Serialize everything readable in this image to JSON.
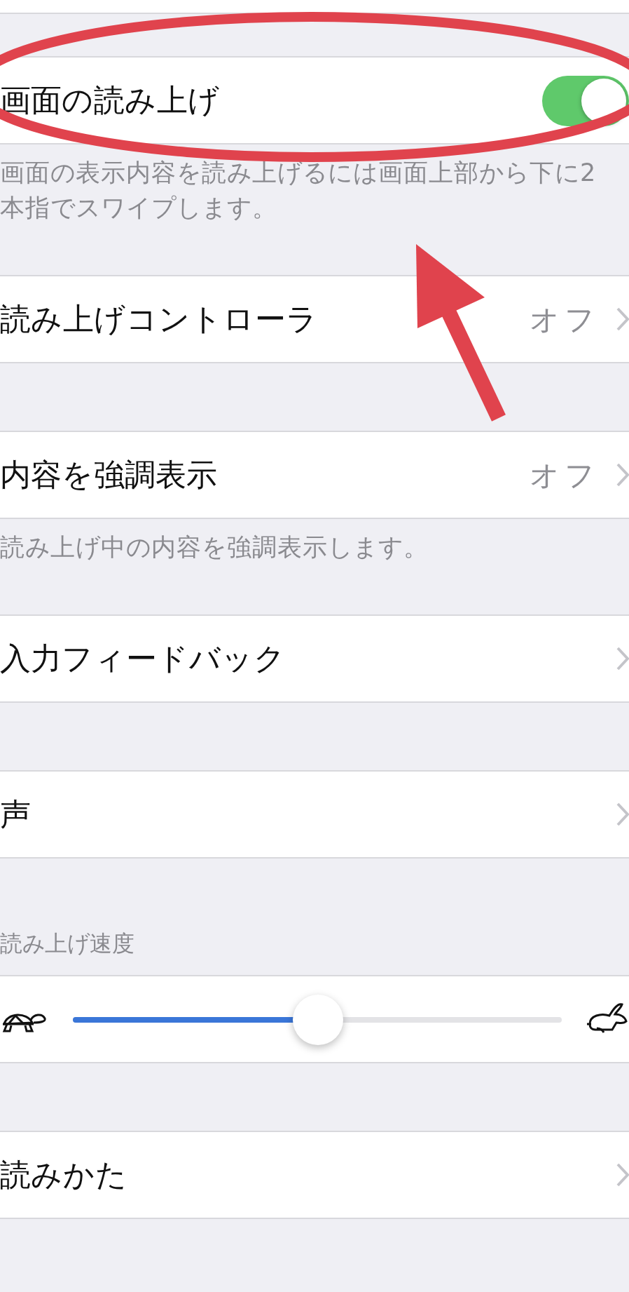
{
  "groups": [
    {
      "rows": [
        {
          "kind": "toggle",
          "label": "画面の読み上げ",
          "on": true
        }
      ],
      "footer": "画面の表示内容を読み上げるには画面上部から下に2本指でスワイプします。"
    },
    {
      "rows": [
        {
          "kind": "link",
          "label": "読み上げコントローラ",
          "value": "オフ"
        }
      ]
    },
    {
      "rows": [
        {
          "kind": "link",
          "label": "内容を強調表示",
          "value": "オフ"
        }
      ],
      "footer": "読み上げ中の内容を強調表示します。"
    },
    {
      "rows": [
        {
          "kind": "link",
          "label": "入力フィードバック"
        }
      ]
    },
    {
      "rows": [
        {
          "kind": "link",
          "label": "声"
        }
      ]
    },
    {
      "header": "読み上げ速度",
      "rows": [
        {
          "kind": "slider",
          "level": 0.5
        }
      ]
    },
    {
      "rows": [
        {
          "kind": "link",
          "label": "読みかた"
        }
      ]
    }
  ],
  "annotations": {
    "ellipse": true,
    "arrow": true
  }
}
